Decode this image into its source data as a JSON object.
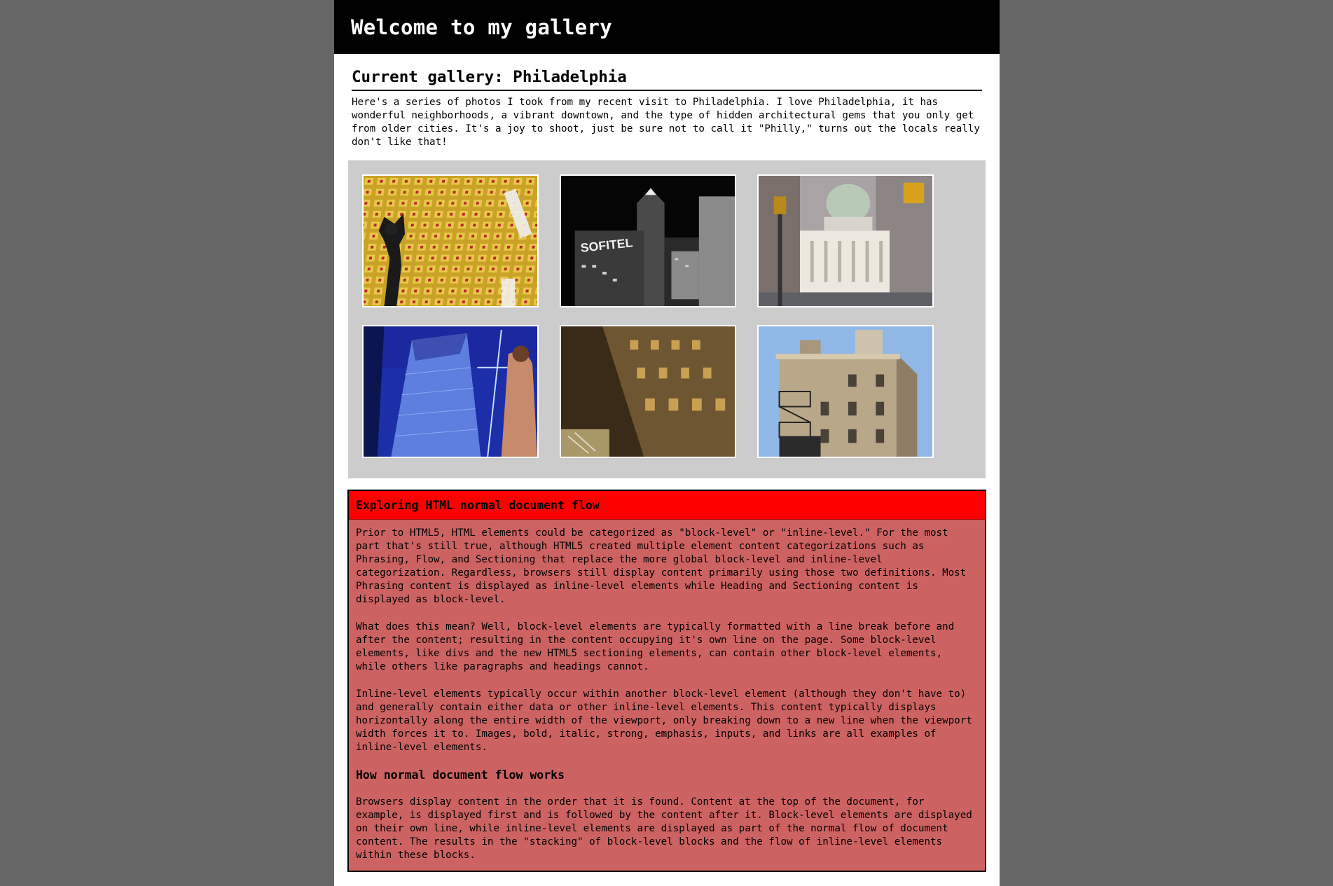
{
  "header": {
    "title": "Welcome to my gallery"
  },
  "main": {
    "gallery_title": "Current gallery: Philadelphia",
    "intro": "Here's a series of photos I took from my recent visit to Philadelphia. I love Philadelphia, it has wonderful neighborhoods, a vibrant downtown, and the type of hidden architectural gems that you only get from older cities. It's a joy to shoot, just be sure not to call it \"Philly,\" turns out the locals really don't like that!",
    "photos": [
      {
        "subject": "coffered gold ceiling with statue",
        "sign_text": ""
      },
      {
        "subject": "black and white night skyline",
        "sign_text": "SOFITEL"
      },
      {
        "subject": "domed classical building on street corner",
        "sign_text": ""
      },
      {
        "subject": "high-rise under construction against blue sky",
        "sign_text": ""
      },
      {
        "subject": "building facade looking down at night",
        "sign_text": ""
      },
      {
        "subject": "brick building with fire escape",
        "sign_text": ""
      }
    ]
  },
  "sidebar": {
    "title": "Exploring HTML normal document flow",
    "paragraphs": [
      "Prior to HTML5, HTML elements could be categorized as \"block-level\" or \"inline-level.\" For the most part that's still true, although HTML5 created multiple element content categorizations such as Phrasing, Flow, and Sectioning that replace the more global block-level and inline-level categorization. Regardless, browsers still display content primarily using those two definitions. Most Phrasing content is displayed as inline-level elements while Heading and Sectioning content is displayed as block-level.",
      "What does this mean? Well, block-level elements are typically formatted with a line break before and after the content; resulting in the content occupying it's own line on the page. Some block-level elements, like divs and the new HTML5 sectioning elements, can contain other block-level elements, while others like paragraphs and headings cannot.",
      "Inline-level elements typically occur within another block-level element (although they don't have to) and generally contain either data or other inline-level elements. This content typically displays horizontally along the entire width of the viewport, only breaking down to a new line when the viewport width forces it to. Images, bold, italic, strong, emphasis, inputs, and links are all examples of inline-level elements."
    ],
    "subheading": "How normal document flow works",
    "closing_paragraph": "Browsers display content in the order that it is found. Content at the top of the document, for example, is displayed first and is followed by the content after it. Block-level elements are displayed on their own line, while inline-level elements are displayed as part of the normal flow of document content. The results in the \"stacking\" of block-level blocks and the flow of inline-level elements within these blocks."
  },
  "colors": {
    "page_background": "#666666",
    "header_background": "#000000",
    "gallery_background": "#cccccc",
    "sidebar_header": "#ff0000",
    "sidebar_body": "#cd6262"
  }
}
